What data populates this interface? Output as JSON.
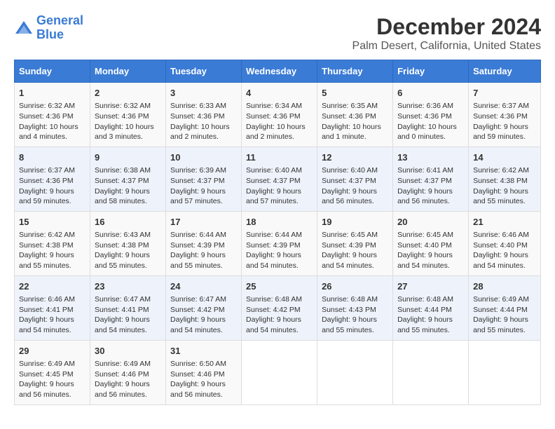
{
  "header": {
    "logo_line1": "General",
    "logo_line2": "Blue",
    "title": "December 2024",
    "subtitle": "Palm Desert, California, United States"
  },
  "columns": [
    "Sunday",
    "Monday",
    "Tuesday",
    "Wednesday",
    "Thursday",
    "Friday",
    "Saturday"
  ],
  "weeks": [
    [
      {
        "day": "1",
        "info": "Sunrise: 6:32 AM\nSunset: 4:36 PM\nDaylight: 10 hours\nand 4 minutes."
      },
      {
        "day": "2",
        "info": "Sunrise: 6:32 AM\nSunset: 4:36 PM\nDaylight: 10 hours\nand 3 minutes."
      },
      {
        "day": "3",
        "info": "Sunrise: 6:33 AM\nSunset: 4:36 PM\nDaylight: 10 hours\nand 2 minutes."
      },
      {
        "day": "4",
        "info": "Sunrise: 6:34 AM\nSunset: 4:36 PM\nDaylight: 10 hours\nand 2 minutes."
      },
      {
        "day": "5",
        "info": "Sunrise: 6:35 AM\nSunset: 4:36 PM\nDaylight: 10 hours\nand 1 minute."
      },
      {
        "day": "6",
        "info": "Sunrise: 6:36 AM\nSunset: 4:36 PM\nDaylight: 10 hours\nand 0 minutes."
      },
      {
        "day": "7",
        "info": "Sunrise: 6:37 AM\nSunset: 4:36 PM\nDaylight: 9 hours\nand 59 minutes."
      }
    ],
    [
      {
        "day": "8",
        "info": "Sunrise: 6:37 AM\nSunset: 4:36 PM\nDaylight: 9 hours\nand 59 minutes."
      },
      {
        "day": "9",
        "info": "Sunrise: 6:38 AM\nSunset: 4:37 PM\nDaylight: 9 hours\nand 58 minutes."
      },
      {
        "day": "10",
        "info": "Sunrise: 6:39 AM\nSunset: 4:37 PM\nDaylight: 9 hours\nand 57 minutes."
      },
      {
        "day": "11",
        "info": "Sunrise: 6:40 AM\nSunset: 4:37 PM\nDaylight: 9 hours\nand 57 minutes."
      },
      {
        "day": "12",
        "info": "Sunrise: 6:40 AM\nSunset: 4:37 PM\nDaylight: 9 hours\nand 56 minutes."
      },
      {
        "day": "13",
        "info": "Sunrise: 6:41 AM\nSunset: 4:37 PM\nDaylight: 9 hours\nand 56 minutes."
      },
      {
        "day": "14",
        "info": "Sunrise: 6:42 AM\nSunset: 4:38 PM\nDaylight: 9 hours\nand 55 minutes."
      }
    ],
    [
      {
        "day": "15",
        "info": "Sunrise: 6:42 AM\nSunset: 4:38 PM\nDaylight: 9 hours\nand 55 minutes."
      },
      {
        "day": "16",
        "info": "Sunrise: 6:43 AM\nSunset: 4:38 PM\nDaylight: 9 hours\nand 55 minutes."
      },
      {
        "day": "17",
        "info": "Sunrise: 6:44 AM\nSunset: 4:39 PM\nDaylight: 9 hours\nand 55 minutes."
      },
      {
        "day": "18",
        "info": "Sunrise: 6:44 AM\nSunset: 4:39 PM\nDaylight: 9 hours\nand 54 minutes."
      },
      {
        "day": "19",
        "info": "Sunrise: 6:45 AM\nSunset: 4:39 PM\nDaylight: 9 hours\nand 54 minutes."
      },
      {
        "day": "20",
        "info": "Sunrise: 6:45 AM\nSunset: 4:40 PM\nDaylight: 9 hours\nand 54 minutes."
      },
      {
        "day": "21",
        "info": "Sunrise: 6:46 AM\nSunset: 4:40 PM\nDaylight: 9 hours\nand 54 minutes."
      }
    ],
    [
      {
        "day": "22",
        "info": "Sunrise: 6:46 AM\nSunset: 4:41 PM\nDaylight: 9 hours\nand 54 minutes."
      },
      {
        "day": "23",
        "info": "Sunrise: 6:47 AM\nSunset: 4:41 PM\nDaylight: 9 hours\nand 54 minutes."
      },
      {
        "day": "24",
        "info": "Sunrise: 6:47 AM\nSunset: 4:42 PM\nDaylight: 9 hours\nand 54 minutes."
      },
      {
        "day": "25",
        "info": "Sunrise: 6:48 AM\nSunset: 4:42 PM\nDaylight: 9 hours\nand 54 minutes."
      },
      {
        "day": "26",
        "info": "Sunrise: 6:48 AM\nSunset: 4:43 PM\nDaylight: 9 hours\nand 55 minutes."
      },
      {
        "day": "27",
        "info": "Sunrise: 6:48 AM\nSunset: 4:44 PM\nDaylight: 9 hours\nand 55 minutes."
      },
      {
        "day": "28",
        "info": "Sunrise: 6:49 AM\nSunset: 4:44 PM\nDaylight: 9 hours\nand 55 minutes."
      }
    ],
    [
      {
        "day": "29",
        "info": "Sunrise: 6:49 AM\nSunset: 4:45 PM\nDaylight: 9 hours\nand 56 minutes."
      },
      {
        "day": "30",
        "info": "Sunrise: 6:49 AM\nSunset: 4:46 PM\nDaylight: 9 hours\nand 56 minutes."
      },
      {
        "day": "31",
        "info": "Sunrise: 6:50 AM\nSunset: 4:46 PM\nDaylight: 9 hours\nand 56 minutes."
      },
      null,
      null,
      null,
      null
    ]
  ]
}
